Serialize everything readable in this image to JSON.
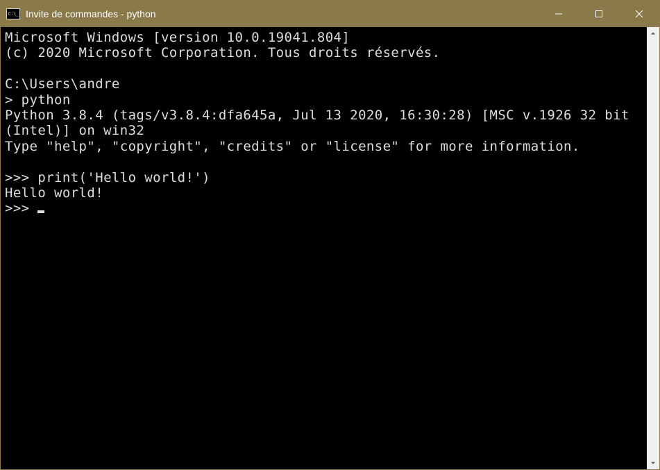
{
  "window": {
    "title": "Invite de commandes - python"
  },
  "terminal": {
    "lines": [
      "Microsoft Windows [version 10.0.19041.804]",
      "(c) 2020 Microsoft Corporation. Tous droits réservés.",
      "",
      "C:\\Users\\andre",
      "> python",
      "Python 3.8.4 (tags/v3.8.4:dfa645a, Jul 13 2020, 16:30:28) [MSC v.1926 32 bit (Intel)] on win32",
      "Type \"help\", \"copyright\", \"credits\" or \"license\" for more information.",
      "",
      ">>> print('Hello world!')",
      "Hello world!",
      ">>> "
    ]
  }
}
